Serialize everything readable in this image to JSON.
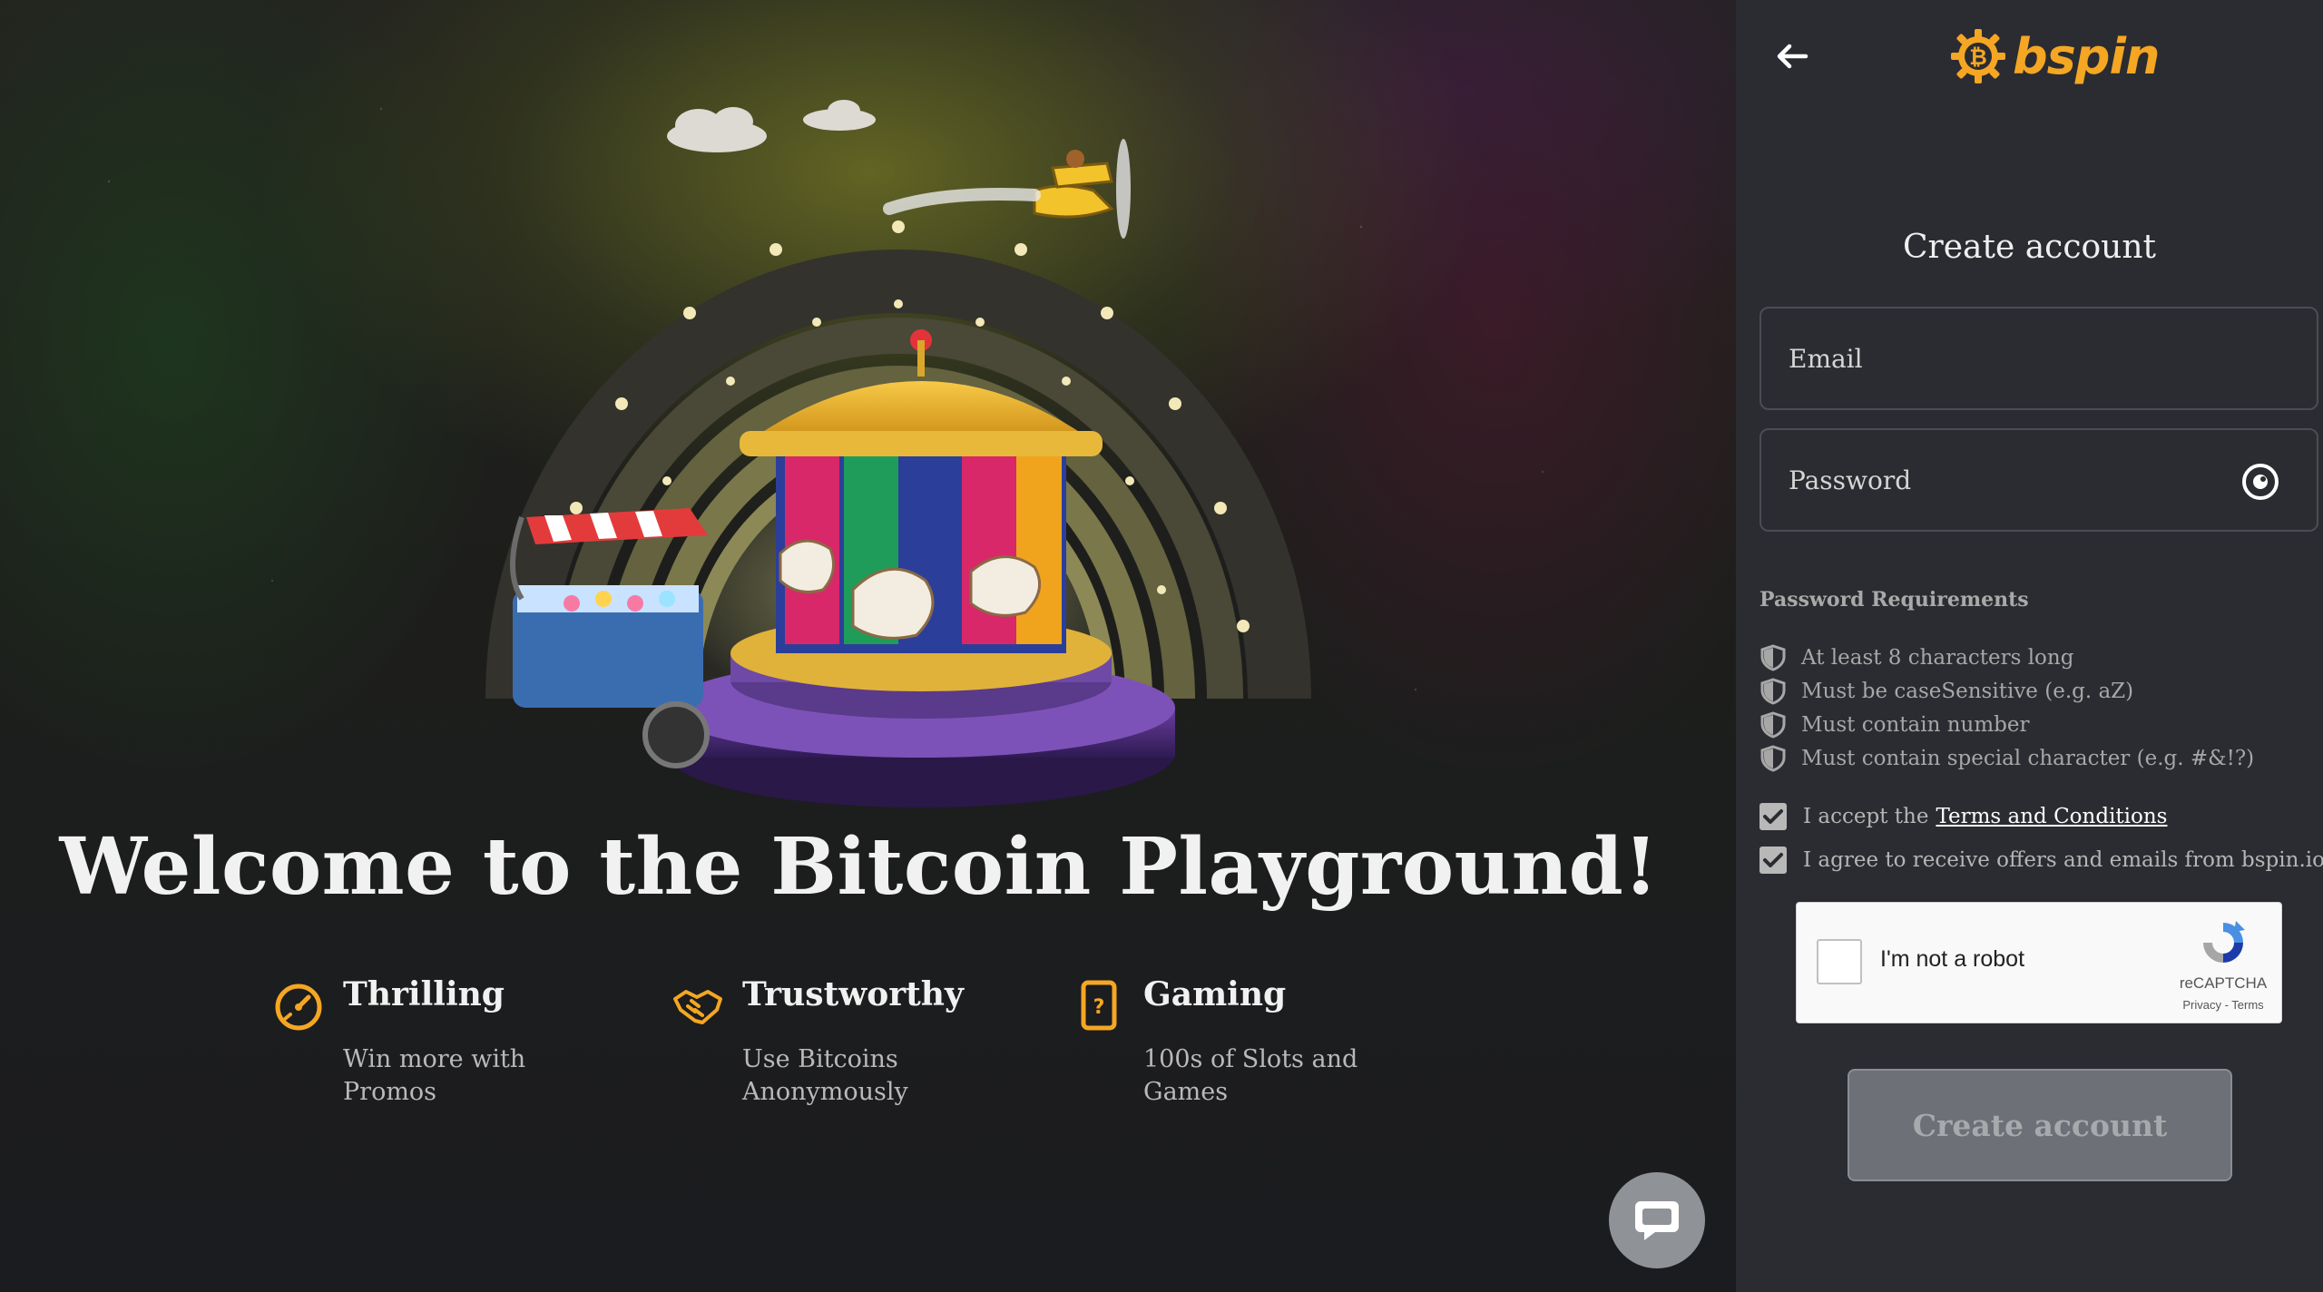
{
  "hero": {
    "headline": "Welcome to the Bitcoin Playground!",
    "features": [
      {
        "title": "Thrilling",
        "description": "Win more with Promos",
        "icon": "speedometer-icon"
      },
      {
        "title": "Trustworthy",
        "description": "Use Bitcoins Anonymously",
        "icon": "handshake-icon"
      },
      {
        "title": "Gaming",
        "description": "100s of Slots and Games",
        "icon": "slot-card-icon"
      }
    ],
    "accent_color": "#f5a623"
  },
  "panel": {
    "logo_text": "bspin",
    "title": "Create account",
    "email_placeholder": "Email",
    "password_placeholder": "Password",
    "requirements_title": "Password Requirements",
    "requirements": [
      "At least 8 characters long",
      "Must be caseSensitive (e.g. aZ)",
      "Must contain number",
      "Must contain special character (e.g. #&!?)"
    ],
    "accept_prefix": "I accept the",
    "terms_link": "Terms and Conditions",
    "offers_label": "I agree to receive offers and emails from bspin.io",
    "recaptcha": {
      "label": "I'm not a robot",
      "brand": "reCAPTCHA",
      "privacy": "Privacy",
      "separator": " - ",
      "terms": "Terms"
    },
    "submit_label": "Create account"
  },
  "colors": {
    "panel_bg": "#2a2c31",
    "button_disabled": "#6d7076",
    "checkbox": "#b8b8b8"
  }
}
